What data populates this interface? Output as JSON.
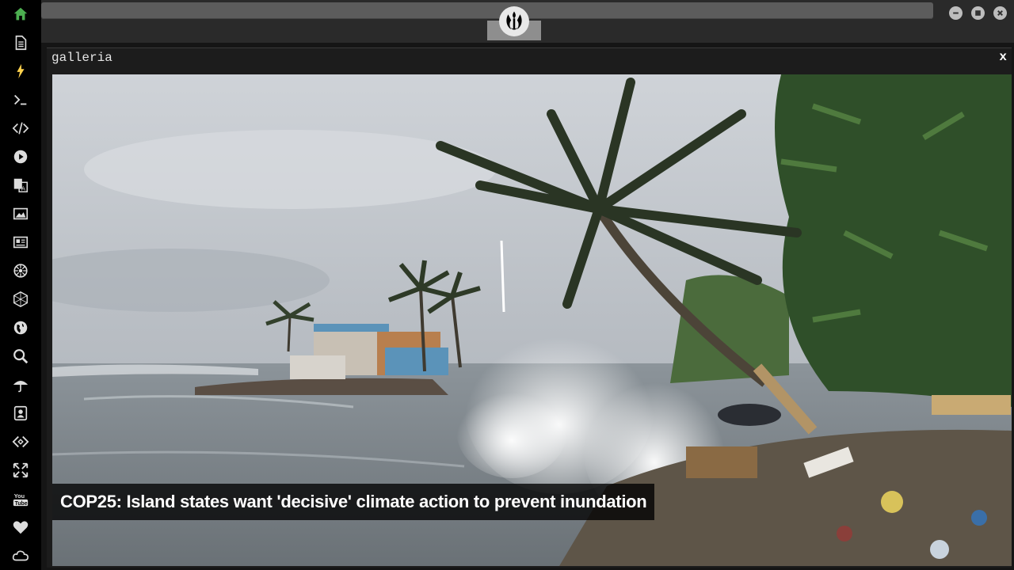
{
  "sidebar": {
    "items": [
      {
        "name": "home-icon",
        "color": "#4caf50"
      },
      {
        "name": "document-icon"
      },
      {
        "name": "lightning-icon",
        "color": "#ffd24d"
      },
      {
        "name": "terminal-icon"
      },
      {
        "name": "code-icon"
      },
      {
        "name": "play-icon"
      },
      {
        "name": "translate-icon"
      },
      {
        "name": "image-icon"
      },
      {
        "name": "newspaper-icon"
      },
      {
        "name": "settings-wheel-icon"
      },
      {
        "name": "hexagon-icon"
      },
      {
        "name": "globe-icon"
      },
      {
        "name": "search-icon"
      },
      {
        "name": "umbrella-icon"
      },
      {
        "name": "contact-card-icon"
      },
      {
        "name": "embed-icon"
      },
      {
        "name": "expand-icon"
      },
      {
        "name": "youtube-icon",
        "label": "You Tube"
      },
      {
        "name": "heart-icon"
      },
      {
        "name": "cloud-icon"
      }
    ]
  },
  "window": {
    "title": "galleria",
    "close_label": "x"
  },
  "gallery": {
    "caption": "COP25: Island states want 'decisive' climate action to prevent inundation"
  },
  "colors": {
    "accent_home": "#4caf50",
    "accent_bolt": "#ffd24d",
    "sidebar_bg": "#000000",
    "chrome_bg": "#2a2a2a"
  }
}
